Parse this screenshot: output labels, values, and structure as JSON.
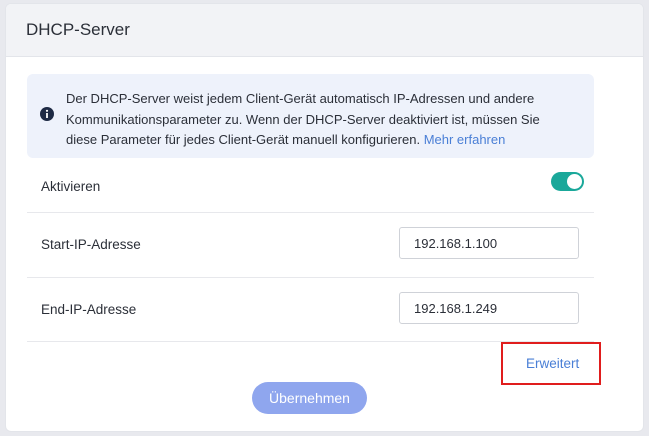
{
  "header": {
    "title": "DHCP-Server"
  },
  "info": {
    "icon": "info-circle-icon",
    "text": "Der DHCP-Server weist jedem Client-Gerät automatisch IP-Adressen und andere Kommunikationsparameter zu. Wenn der DHCP-Server deaktiviert ist, müssen Sie diese Parameter für jedes Client-Gerät manuell konfigurieren.",
    "link_label": "Mehr erfahren"
  },
  "enable": {
    "label": "Aktivieren",
    "enabled": true,
    "toggle_color": "#1aa89a"
  },
  "start_ip": {
    "label": "Start-IP-Adresse",
    "value": "192.168.1.100"
  },
  "end_ip": {
    "label": "End-IP-Adresse",
    "value": "192.168.1.249"
  },
  "advanced": {
    "label": "Erweitert",
    "highlight_color": "#e01d1d"
  },
  "apply_button": {
    "label": "Übernehmen",
    "color": "#8fa6ee"
  }
}
